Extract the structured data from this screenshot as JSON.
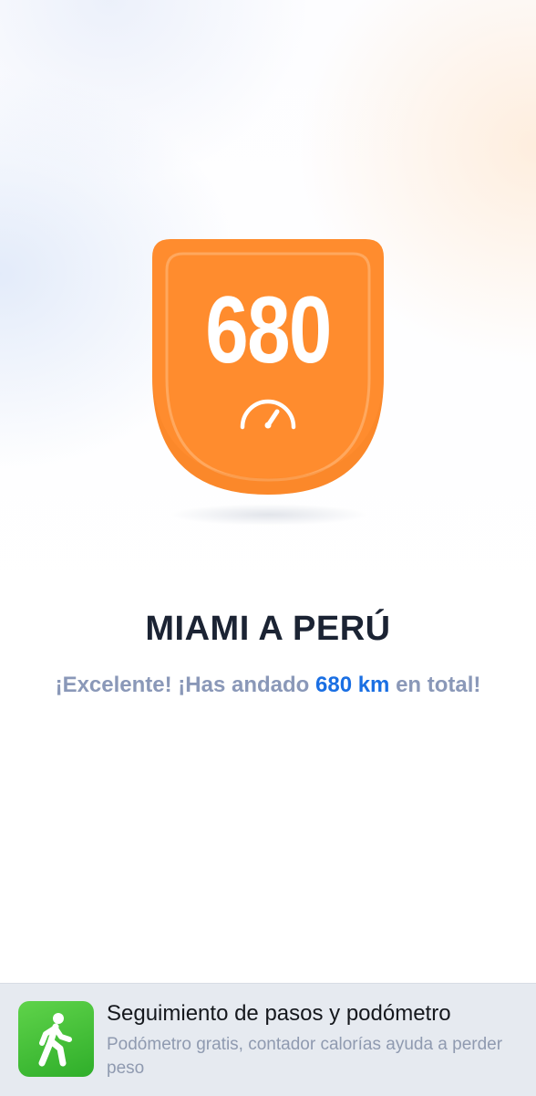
{
  "badge": {
    "value": "680",
    "icon": "speedometer-icon",
    "color": "#FF8C2E",
    "color_dark": "#F5842A"
  },
  "title": "MIAMI A PERÚ",
  "message": {
    "before": "¡Excelente! ¡Has andado ",
    "highlight": "680 km",
    "after": " en total!",
    "highlight_color": "#1A6FE3"
  },
  "ad": {
    "icon": "walking-person-icon",
    "title": "Seguimiento de pasos y podómetro",
    "description": "Podómetro gratis, contador calorías ayuda a perder peso",
    "icon_color": "#3CBF34"
  }
}
